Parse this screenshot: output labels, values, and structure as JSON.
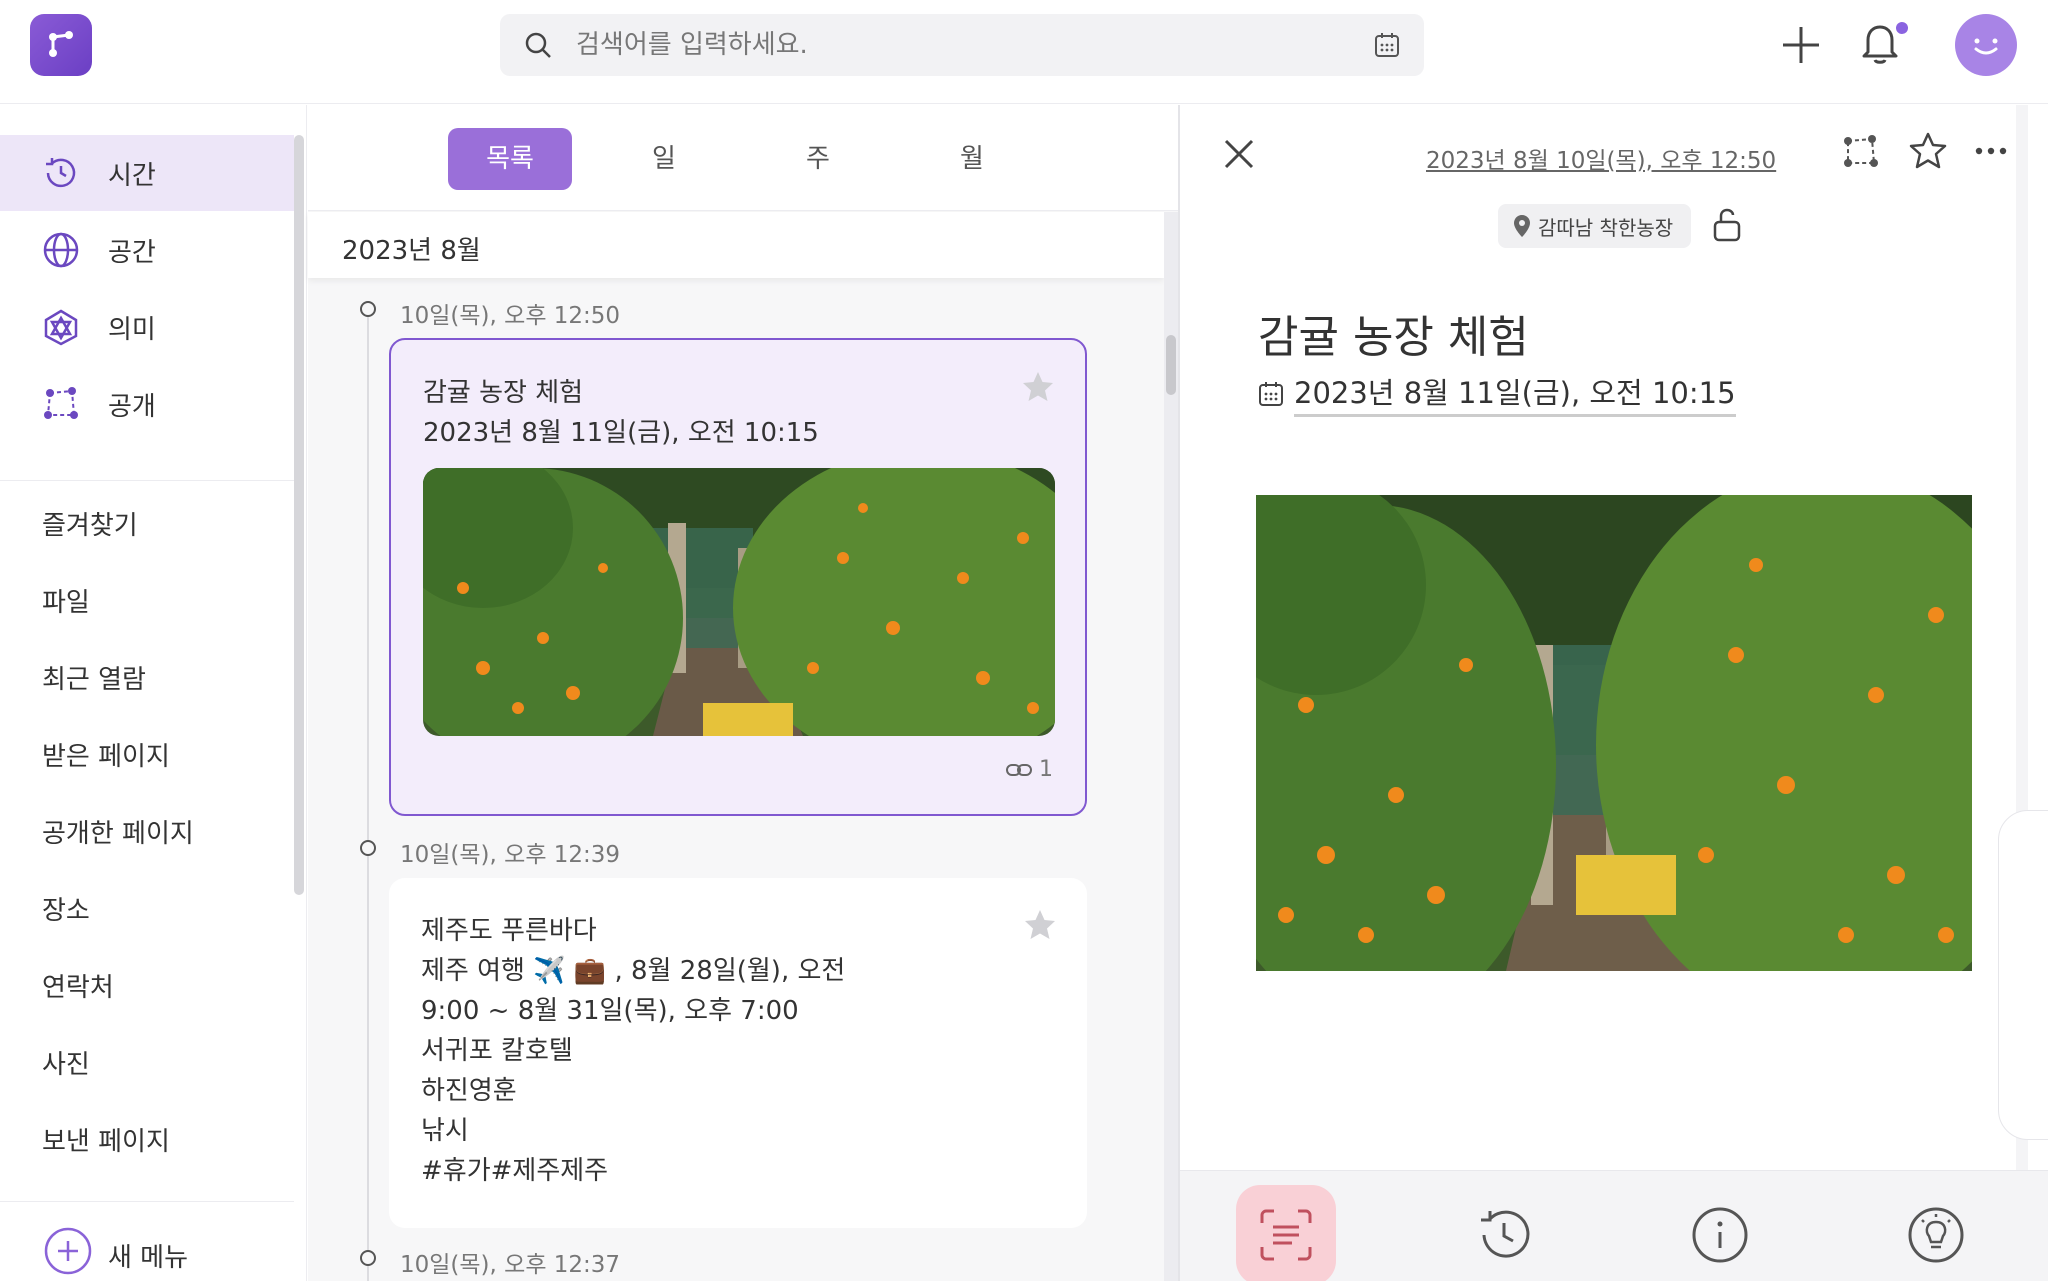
{
  "search": {
    "placeholder": "검색어를 입력하세요."
  },
  "sidebar": {
    "nav": [
      {
        "label": "시간",
        "icon": "clock-history-icon"
      },
      {
        "label": "공간",
        "icon": "globe-icon"
      },
      {
        "label": "의미",
        "icon": "meaning-network-icon"
      },
      {
        "label": "공개",
        "icon": "share-network-icon"
      }
    ],
    "links": [
      "즐겨찾기",
      "파일",
      "최근 열람",
      "받은 페이지",
      "공개한 페이지",
      "장소",
      "연락처",
      "사진",
      "보낸 페이지"
    ],
    "new_menu": "새 메뉴"
  },
  "tabs": [
    "목록",
    "일",
    "주",
    "월"
  ],
  "active_tab": "목록",
  "month_header": "2023년 8월",
  "timeline": [
    {
      "time": "10일(목), 오후 12:50",
      "title": "감귤 농장 체험",
      "lines": [
        "2023년 8월 11일(금), 오전 10:15"
      ],
      "has_image": true,
      "link_count": "1"
    },
    {
      "time": "10일(목), 오후 12:39",
      "title": "제주도 푸른바다",
      "lines": [
        "제주 여행 ✈️ 💼 , 8월 28일(월), 오전",
        "9:00 ~ 8월 31일(목), 오후 7:00",
        "서귀포 칼호텔",
        "하진영훈",
        "낚시",
        "#휴가#제주제주"
      ]
    },
    {
      "time": "10일(목), 오후 12:37"
    }
  ],
  "detail": {
    "created": "2023년 8월 10일(목), 오후 12:50",
    "location": "감따남 착한농장",
    "title": "감귤 농장 체험",
    "event_date": "2023년 8월 11일(금), 오전 10:15"
  },
  "colors": {
    "accent": "#9a6fd9",
    "selected_border": "#8058d0",
    "active_nav_bg": "#ede6f8"
  }
}
